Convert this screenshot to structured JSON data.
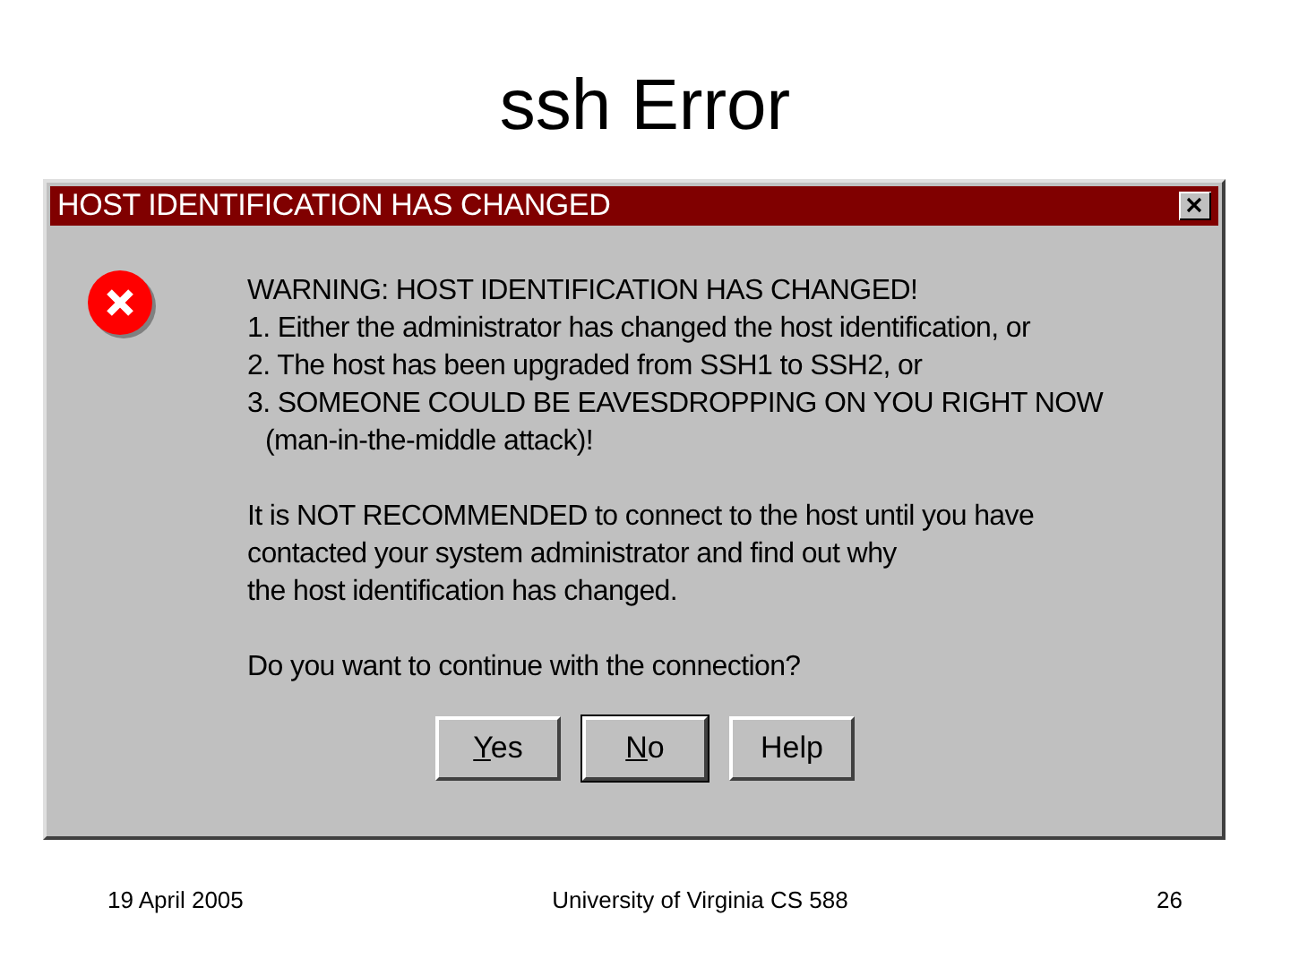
{
  "slide": {
    "title": "ssh Error"
  },
  "dialog": {
    "title": "HOST IDENTIFICATION HAS CHANGED",
    "warning_lines": [
      {
        "text": "WARNING: HOST IDENTIFICATION HAS CHANGED!",
        "kind": "line"
      },
      {
        "text": "1. Either the administrator has changed the host identification, or",
        "kind": "line"
      },
      {
        "text": "2. The host has been upgraded from SSH1 to SSH2, or",
        "kind": "line"
      },
      {
        "text": "3. SOMEONE COULD BE EAVESDROPPING ON YOU RIGHT NOW",
        "kind": "line"
      },
      {
        "text": "(man-in-the-middle attack)!",
        "kind": "indent"
      }
    ],
    "advice_lines": [
      "It is NOT RECOMMENDED to connect to the host until you have",
      "contacted your system administrator and find out why",
      "the host identification has changed."
    ],
    "question": "Do you want to continue with the connection?",
    "buttons": [
      {
        "mnemonic": "Y",
        "rest": "es",
        "default": false
      },
      {
        "mnemonic": "N",
        "rest": "o",
        "default": true
      },
      {
        "rest": "Help",
        "default": false
      }
    ]
  },
  "footer": {
    "date": "19 April 2005",
    "course": "University of Virginia CS 588",
    "page": "26"
  }
}
